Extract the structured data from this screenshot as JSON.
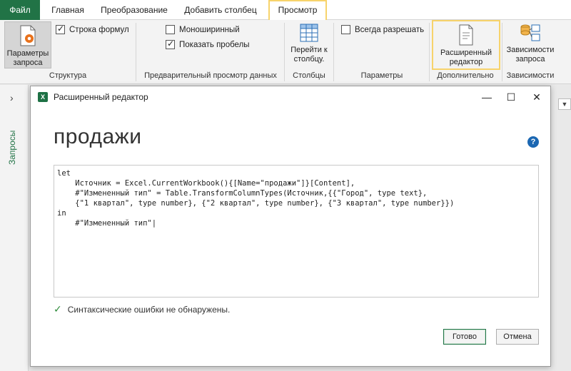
{
  "tabs": [
    "Файл",
    "Главная",
    "Преобразование",
    "Добавить столбец",
    "Просмотр"
  ],
  "active_tab": "Просмотр",
  "ribbon": {
    "query_params": "Параметры\nзапроса",
    "formula_bar": "Строка формул",
    "group_structure": "Структура",
    "monospace": "Моноширинный",
    "show_whitespace": "Показать пробелы",
    "group_preview": "Предварительный просмотр данных",
    "goto_column": "Перейти к\nстолбцу.",
    "group_columns": "Столбцы",
    "always_allow": "Всегда разрешать",
    "group_params": "Параметры",
    "advanced_editor": "Расширенный\nредактор",
    "group_advanced": "Дополнительно",
    "query_deps": "Зависимости\nзапроса",
    "group_deps": "Зависимости"
  },
  "checkboxes": {
    "formula_bar": true,
    "monospace": false,
    "show_whitespace": true,
    "always_allow": false
  },
  "sidebar": {
    "queries_label": "Запросы",
    "collapse_glyph": "›"
  },
  "dialog": {
    "title": "Расширенный редактор",
    "query_name": "продажи",
    "code": "let\n    Источник = Excel.CurrentWorkbook(){[Name=\"продажи\"]}[Content],\n    #\"Измененный тип\" = Table.TransformColumnTypes(Источник,{{\"Город\", type text},\n    {\"1 квартал\", type number}, {\"2 квартал\", type number}, {\"3 квартал\", type number}})\nin\n    #\"Измененный тип\"|",
    "status": "Синтаксические ошибки не обнаружены.",
    "done": "Готово",
    "cancel": "Отмена",
    "help_glyph": "?"
  },
  "colors": {
    "excel_green": "#217346",
    "highlight": "#f7d36b",
    "help_blue": "#1b67b2"
  }
}
